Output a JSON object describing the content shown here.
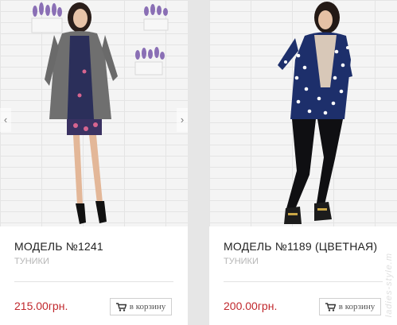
{
  "products": [
    {
      "title": "МОДЕЛЬ №1241",
      "category": "ТУНИКИ",
      "price": "215.00грн.",
      "cart_label": "в корзину",
      "image_desc": "woman in grey coat and floral dress"
    },
    {
      "title": "МОДЕЛЬ №1189 (ЦВЕТНАЯ)",
      "category": "ТУНИКИ",
      "price": "200.00грн.",
      "cart_label": "в корзину",
      "image_desc": "woman in navy polka-dot hooded jacket"
    }
  ],
  "slider": {
    "prev_icon": "chevron-left-icon",
    "next_icon": "chevron-right-icon",
    "prev_glyph": "‹",
    "next_glyph": "›"
  },
  "watermark": "ladies-style.m",
  "colors": {
    "price": "#c0282d",
    "category": "#b5b5b5",
    "background": "#e6e6e6"
  }
}
